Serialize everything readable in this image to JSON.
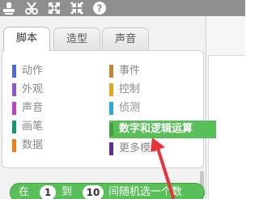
{
  "toolbar": {
    "icons": [
      "stamp-icon",
      "scissors-icon",
      "grow-icon",
      "shrink-icon",
      "help-icon"
    ],
    "help_glyph": "?"
  },
  "tabs": [
    {
      "label": "脚本",
      "active": true
    },
    {
      "label": "造型",
      "active": false
    },
    {
      "label": "声音",
      "active": false
    }
  ],
  "categories": [
    {
      "label": "动作",
      "color": "#4a6cd4"
    },
    {
      "label": "事件",
      "color": "#c88330"
    },
    {
      "label": "外观",
      "color": "#8a55d7"
    },
    {
      "label": "控制",
      "color": "#e1a91a"
    },
    {
      "label": "声音",
      "color": "#bb42c3"
    },
    {
      "label": "侦测",
      "color": "#2ca5e2"
    },
    {
      "label": "画笔",
      "color": "#0e9a6c"
    },
    {
      "label": "数字和逻辑运算",
      "color": "#5cb712",
      "selected": true
    },
    {
      "label": "数据",
      "color": "#ee7d16"
    },
    {
      "label": "更多模块",
      "color": "#632d99"
    }
  ],
  "block": {
    "parts": [
      "在",
      "1",
      "到",
      "10",
      "间随机选一个数"
    ],
    "color": "#59c059"
  },
  "colors": {
    "toolbar_bg": "#8f8f8f",
    "arrow": "#e8323c"
  }
}
